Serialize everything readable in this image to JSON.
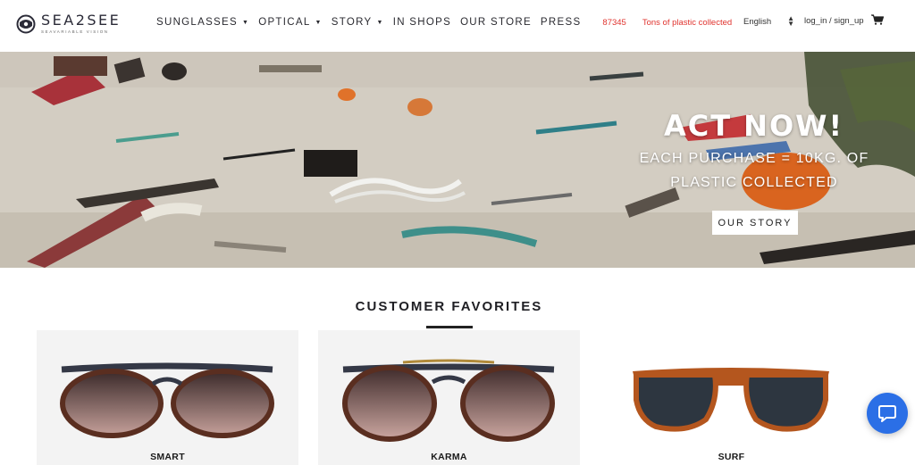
{
  "brand": {
    "name": "SEA2SEE",
    "tagline": "SEAVARIABLE VISION"
  },
  "nav": {
    "items": [
      {
        "label": "SUNGLASSES",
        "has_dropdown": true
      },
      {
        "label": "OPTICAL",
        "has_dropdown": true
      },
      {
        "label": "STORY",
        "has_dropdown": true
      },
      {
        "label": "IN SHOPS",
        "has_dropdown": false
      },
      {
        "label": "OUR STORE",
        "has_dropdown": false
      },
      {
        "label": "PRESS",
        "has_dropdown": false
      }
    ],
    "counter_value": "87345",
    "counter_label": "Tons of plastic collected",
    "language": "English",
    "login": "log_in / sign_up",
    "cart_icon": "cart-icon"
  },
  "hero": {
    "title": "ACT NOW!",
    "subtitle_line1": "EACH PURCHASE = 10KG. OF",
    "subtitle_line2": "PLASTIC COLLECTED",
    "button": "OUR STORY"
  },
  "favorites": {
    "heading": "CUSTOMER FAVORITES",
    "products": [
      {
        "name": "SMART"
      },
      {
        "name": "KARMA"
      },
      {
        "name": "SURF"
      }
    ]
  },
  "colors": {
    "accent_red": "#e0342f",
    "chat_blue": "#2b6fe6",
    "text_dark": "#2a2a30"
  },
  "chat": {
    "icon": "chat-bubble-icon"
  }
}
